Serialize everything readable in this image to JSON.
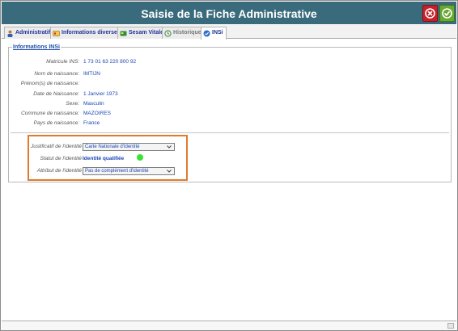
{
  "window": {
    "title": "Saisie de la Fiche Administrative"
  },
  "toolbar": {
    "close_icon": "close-circle-icon",
    "validate_icon": "check-circle-icon"
  },
  "tabs": [
    {
      "label": "Administratif",
      "icon": "person-icon",
      "state": "normal"
    },
    {
      "label": "Informations diverses",
      "icon": "id-card-icon",
      "state": "normal"
    },
    {
      "label": "Sesam Vitale",
      "icon": "card-icon",
      "state": "normal"
    },
    {
      "label": "Historique",
      "icon": "history-icon",
      "state": "disabled"
    },
    {
      "label": "INSi",
      "icon": "check-badge-icon",
      "state": "active"
    }
  ],
  "insi": {
    "legend": "Informations INSi",
    "fields": [
      {
        "label": "Matricule INS:",
        "value": "1 73 01 63 220 800  92"
      },
      {
        "label": "Nom de naissance:",
        "value": "IMTIJN"
      },
      {
        "label": "Prénom(s) de naissance:",
        "value": ""
      },
      {
        "label": "Date de Naissance:",
        "value": "1 Janvier 1973"
      },
      {
        "label": "Sexe:",
        "value": "Masculin"
      },
      {
        "label": "Commune de naissance:",
        "value": "MAZOIRES"
      },
      {
        "label": "Pays de naissance:",
        "value": "France"
      }
    ],
    "identity": {
      "justificatif_label": "Justificatif de l'identité",
      "justificatif_value": "Carte Nationale d'Identité",
      "statut_label": "Statut de l'identité",
      "statut_value": "Identité qualifiée",
      "statut_color": "#39e331",
      "attribut_label": "Attribut de l'identité",
      "attribut_value": "Pas de complément d'identité"
    }
  }
}
